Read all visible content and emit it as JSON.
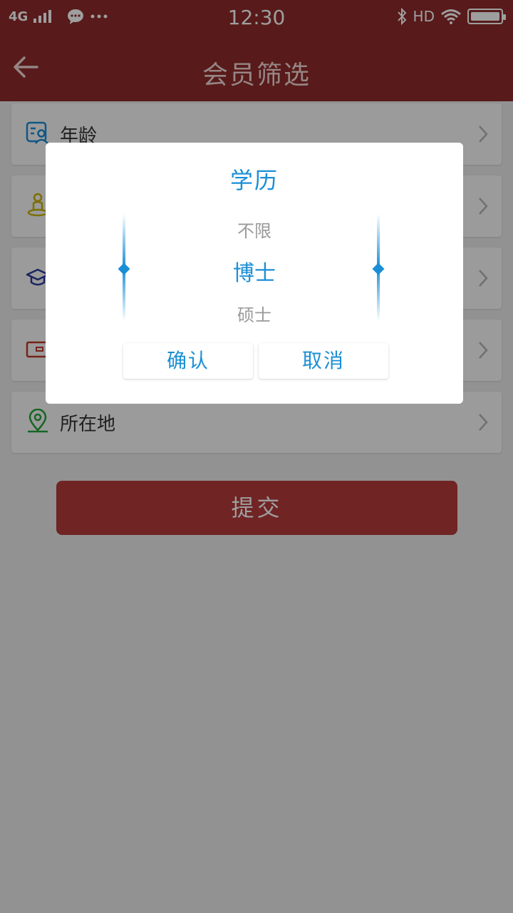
{
  "status_bar": {
    "network": "4G",
    "time": "12:30",
    "hd": "HD",
    "icons": [
      "signal-icon",
      "chat-icon",
      "more-icon",
      "bluetooth-icon",
      "wifi-icon",
      "battery-icon"
    ]
  },
  "header": {
    "title": "会员筛选",
    "back_icon": "back-arrow-icon"
  },
  "filters": [
    {
      "label": "年龄",
      "icon": "age-card-icon",
      "color": "#1b8fd6"
    },
    {
      "label": "",
      "icon": "person-icon",
      "color": "#c8b400"
    },
    {
      "label": "",
      "icon": "graduation-cap-icon",
      "color": "#2a3a9a"
    },
    {
      "label": "",
      "icon": "wallet-icon",
      "color": "#c0392b"
    },
    {
      "label": "所在地",
      "icon": "location-pin-icon",
      "color": "#22a33a"
    }
  ],
  "submit_label": "提交",
  "dialog": {
    "title": "学历",
    "options": [
      "不限",
      "博士",
      "硕士"
    ],
    "selected": "博士",
    "confirm_label": "确认",
    "cancel_label": "取消"
  },
  "colors": {
    "primary": "#8f2a2a",
    "accent": "#1b8fd6",
    "submit": "#b53a3a"
  }
}
